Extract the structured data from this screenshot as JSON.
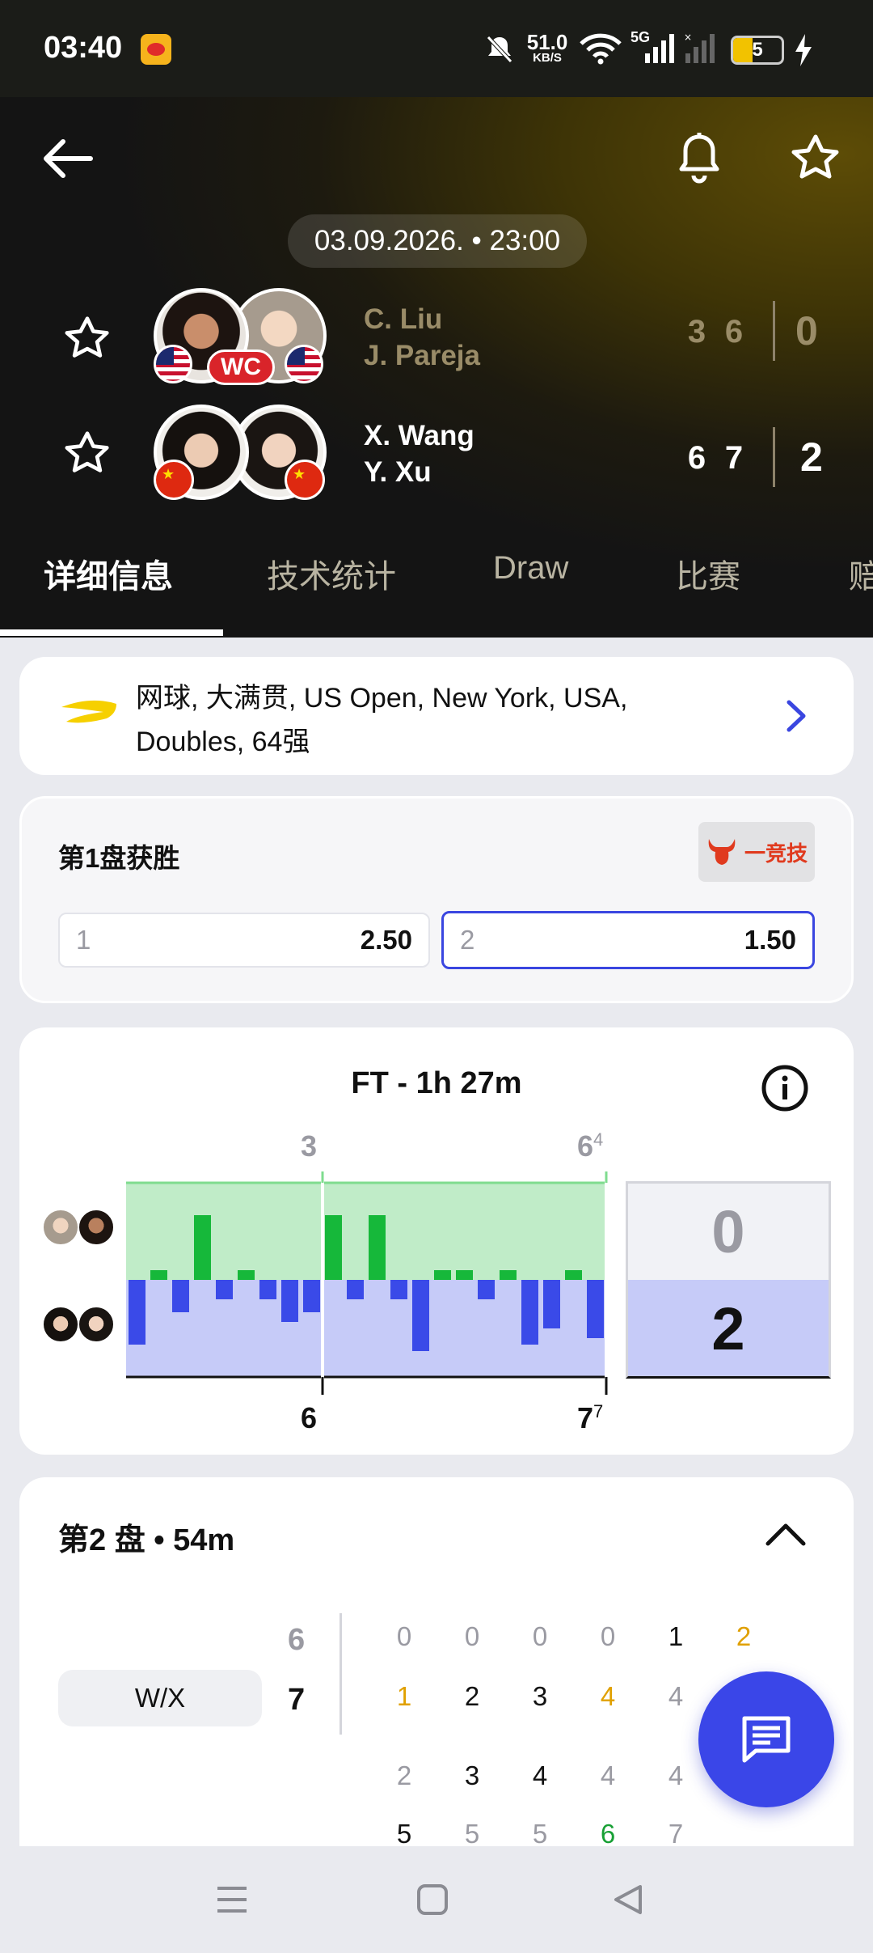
{
  "status_bar": {
    "time": "03:40",
    "net_speed": "51.0",
    "net_unit": "KB/S",
    "net_type": "5G",
    "battery": "5"
  },
  "match": {
    "datetime": "03.09.2026. • 23:00",
    "team1": {
      "player1": "C. Liu",
      "player2": "J. Pareja",
      "badge": "WC",
      "sets": [
        "3",
        "6"
      ],
      "total": "0"
    },
    "team2": {
      "player1": "X. Wang",
      "player2": "Y. Xu",
      "sets": [
        "6",
        "7"
      ],
      "total": "2"
    }
  },
  "tabs": [
    {
      "label": "详细信息"
    },
    {
      "label": "技术统计"
    },
    {
      "label": "Draw"
    },
    {
      "label": "比赛"
    },
    {
      "label": "赔"
    }
  ],
  "tournament": {
    "line1": "网球, 大满贯, US Open, New York, USA,",
    "line2": "Doubles, 64强"
  },
  "odds": {
    "title": "第1盘获胜",
    "sponsor": "一竞技",
    "options": [
      {
        "label": "1",
        "value": "2.50"
      },
      {
        "label": "2",
        "value": "1.50"
      }
    ]
  },
  "momentum": {
    "title": "FT - 1h 27m",
    "top_labels": [
      {
        "main": "3",
        "sup": ""
      },
      {
        "main": "6",
        "sup": "4"
      }
    ],
    "bottom_labels": [
      {
        "main": "6",
        "sup": ""
      },
      {
        "main": "7",
        "sup": "7"
      }
    ],
    "score_top": "0",
    "score_bottom": "2",
    "chart_data": {
      "type": "bar",
      "x": [
        1,
        2,
        3,
        4,
        5,
        6,
        7,
        8,
        9,
        10,
        11,
        12,
        13,
        14,
        15,
        16,
        17,
        18,
        19,
        20,
        21,
        22
      ],
      "series": [
        {
          "values": [
            -2,
            0.3,
            -1,
            2,
            -0.6,
            0.3,
            -0.6,
            -1.3,
            -1,
            2,
            -0.6,
            2,
            -0.6,
            -2.2,
            0.3,
            0.3,
            -0.6,
            0.3,
            -2,
            -1.5,
            0.3,
            -1.8
          ]
        }
      ],
      "ylim": [
        -3,
        3
      ],
      "set_boundaries": [
        9,
        22
      ]
    }
  },
  "set2": {
    "title": "第2 盘 • 54m",
    "team_label": "W/X",
    "score_top": "6",
    "score_bottom": "7",
    "rows": [
      [
        {
          "v": "0",
          "c": "#9a9aa2"
        },
        {
          "v": "0",
          "c": "#9a9aa2"
        },
        {
          "v": "0",
          "c": "#9a9aa2"
        },
        {
          "v": "0",
          "c": "#9a9aa2"
        },
        {
          "v": "1",
          "c": "#111111"
        },
        {
          "v": "2",
          "c": "#e0a000"
        }
      ],
      [
        {
          "v": "1",
          "c": "#e0a000"
        },
        {
          "v": "2",
          "c": "#111111"
        },
        {
          "v": "3",
          "c": "#111111"
        },
        {
          "v": "4",
          "c": "#e0a000"
        },
        {
          "v": "4",
          "c": "#9a9aa2"
        }
      ],
      [
        {
          "v": "2",
          "c": "#9a9aa2"
        },
        {
          "v": "3",
          "c": "#111111"
        },
        {
          "v": "4",
          "c": "#111111"
        },
        {
          "v": "4",
          "c": "#9a9aa2"
        },
        {
          "v": "4",
          "c": "#9a9aa2"
        }
      ],
      [
        {
          "v": "5",
          "c": "#111111"
        },
        {
          "v": "5",
          "c": "#9a9aa2"
        },
        {
          "v": "5",
          "c": "#9a9aa2"
        },
        {
          "v": "6",
          "c": "#18a035"
        },
        {
          "v": "7",
          "c": "#9a9aa2"
        }
      ]
    ]
  },
  "colors": {
    "green": "#16b83a",
    "blue": "#3a4ae8",
    "accent_blue": "#3a46e0"
  }
}
